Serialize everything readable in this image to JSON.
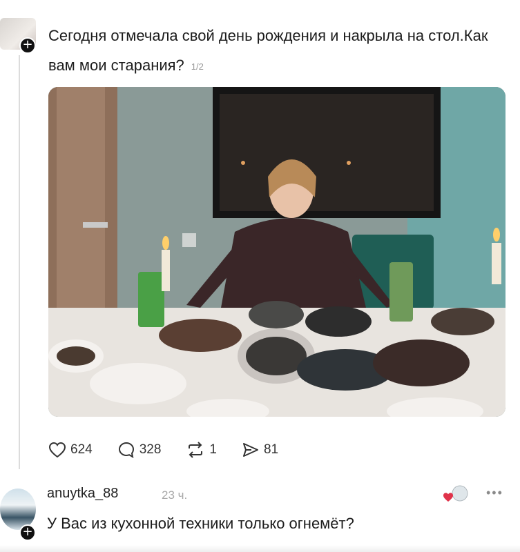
{
  "post": {
    "caption": "Сегодня отмечала свой день рождения и накрыла на стол.Как вам мои старания?",
    "page_indicator": "1/2",
    "photo_alt": "",
    "stats": {
      "likes": "624",
      "comments": "328",
      "reposts": "1",
      "shares": "81"
    }
  },
  "comment": {
    "username": "anuytka_88",
    "time": "23 ч.",
    "text": "У Вас из кухонной техники только огнемёт?"
  },
  "colors": {
    "text": "#1c1c1c",
    "muted": "#a8a8a8",
    "badge": "#111111",
    "like_heart": "#e0324a"
  }
}
